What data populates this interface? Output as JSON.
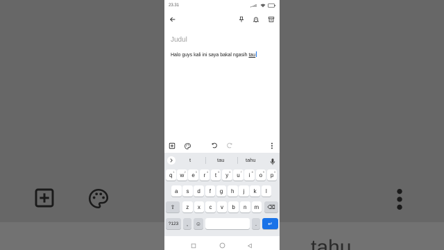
{
  "status": {
    "time": "23.31",
    "icons": [
      "signal-icon",
      "wifi-icon",
      "battery-icon"
    ]
  },
  "toolbar": {
    "back_icon": "arrow-back-icon",
    "pin_icon": "pin-icon",
    "reminder_icon": "bell-icon",
    "archive_icon": "archive-icon"
  },
  "note": {
    "title_placeholder": "Judul",
    "body_text": "Halo guys kali ini saya bakal ngasih ",
    "body_current_word": "tau"
  },
  "editor_bar": {
    "add_icon": "add-box-icon",
    "palette_icon": "palette-icon",
    "undo_icon": "undo-icon",
    "redo_icon": "redo-icon",
    "more_icon": "more-vert-icon"
  },
  "keyboard": {
    "suggestions": [
      "t",
      "tau",
      "tahu"
    ],
    "row1": [
      {
        "k": "q",
        "n": "1"
      },
      {
        "k": "w",
        "n": "2"
      },
      {
        "k": "e",
        "n": "3"
      },
      {
        "k": "r",
        "n": "4"
      },
      {
        "k": "t",
        "n": "5"
      },
      {
        "k": "y",
        "n": "6"
      },
      {
        "k": "u",
        "n": "7"
      },
      {
        "k": "i",
        "n": "8"
      },
      {
        "k": "o",
        "n": "9"
      },
      {
        "k": "p",
        "n": "0"
      }
    ],
    "row2": [
      "a",
      "s",
      "d",
      "f",
      "g",
      "h",
      "j",
      "k",
      "l"
    ],
    "row3": [
      "z",
      "x",
      "c",
      "v",
      "b",
      "n",
      "m"
    ],
    "symbols_label": "?123",
    "comma_label": ",",
    "period_label": ".",
    "enter_label": "↵",
    "shift_label": "⇧",
    "backspace_label": "⌫",
    "emoji_label": "☺",
    "mic_icon": "microphone-icon",
    "expand_icon": "chevron-right-icon"
  },
  "background": {
    "right_text": "tahu"
  },
  "colors": {
    "accent": "#1a73e8",
    "keyboard_bg": "#e8eaed"
  }
}
